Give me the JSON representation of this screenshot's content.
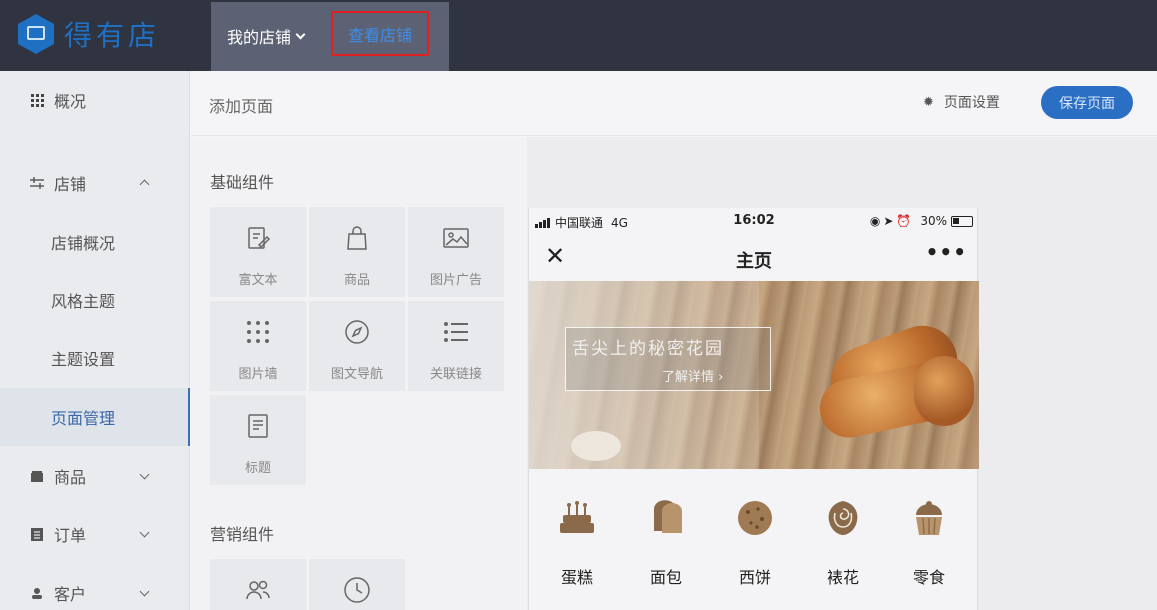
{
  "brand": {
    "name": "得有店",
    "color": "#1f6fc2"
  },
  "topbar": {
    "my_store": "我的店铺",
    "view_store": "查看店铺"
  },
  "sidebar": {
    "overview": "概况",
    "store": "店铺",
    "store_items": [
      "店铺概况",
      "风格主题",
      "主题设置",
      "页面管理"
    ],
    "active_item": "页面管理",
    "goods": "商品",
    "orders": "订单",
    "customers": "客户"
  },
  "header": {
    "add_page": "添加页面",
    "page_settings": "页面设置",
    "save": "保存页面"
  },
  "components": {
    "basic_title": "基础组件",
    "basic": [
      {
        "label": "富文本",
        "icon": "edit-doc-icon"
      },
      {
        "label": "商品",
        "icon": "shopping-bag-icon"
      },
      {
        "label": "图片广告",
        "icon": "image-icon"
      },
      {
        "label": "图片墙",
        "icon": "grid-dots-icon"
      },
      {
        "label": "图文导航",
        "icon": "compass-icon"
      },
      {
        "label": "关联链接",
        "icon": "list-icon"
      },
      {
        "label": "标题",
        "icon": "title-doc-icon"
      }
    ],
    "marketing_title": "营销组件",
    "marketing": [
      {
        "icon": "users-icon"
      },
      {
        "icon": "clock-icon"
      }
    ]
  },
  "phone": {
    "carrier": "中国联通",
    "network": "4G",
    "time": "16:02",
    "battery": "30%",
    "page_title": "主页",
    "banner_title": "舌尖上的秘密花园",
    "banner_link": "了解详情 ›",
    "categories": [
      {
        "label": "蛋糕",
        "icon": "cake-icon"
      },
      {
        "label": "面包",
        "icon": "bread-icon"
      },
      {
        "label": "西饼",
        "icon": "cookie-icon"
      },
      {
        "label": "裱花",
        "icon": "rose-icon"
      },
      {
        "label": "零食",
        "icon": "cupcake-icon"
      }
    ],
    "icon_color": "#8a6a4a"
  }
}
